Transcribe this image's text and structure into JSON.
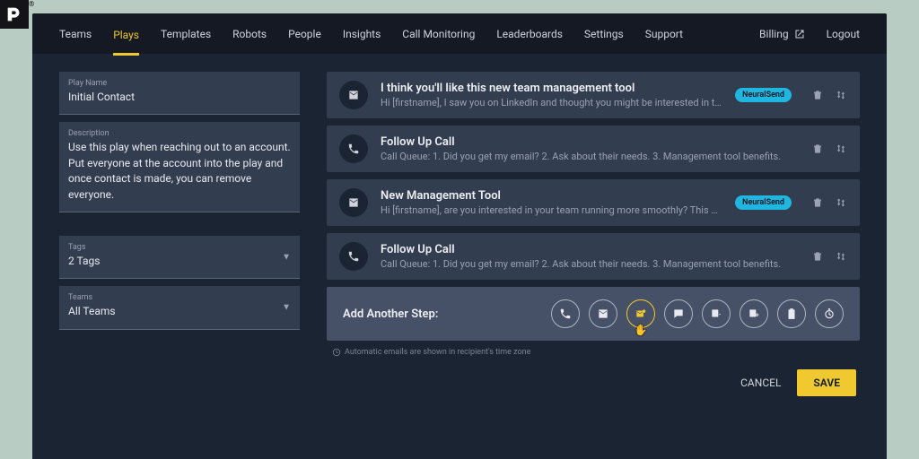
{
  "nav": {
    "items": [
      "Teams",
      "Plays",
      "Templates",
      "Robots",
      "People",
      "Insights",
      "Call Monitoring",
      "Leaderboards",
      "Settings",
      "Support"
    ],
    "active_index": 1,
    "billing": "Billing",
    "logout": "Logout"
  },
  "form": {
    "play_name_label": "Play Name",
    "play_name_value": "Initial Contact",
    "description_label": "Description",
    "description_value": "Use this play when reaching out to an account. Put everyone at the account into the play and once contact is made, you can remove everyone.",
    "tags_label": "Tags",
    "tags_value": "2 Tags",
    "teams_label": "Teams",
    "teams_value": "All Teams"
  },
  "steps": [
    {
      "icon": "email",
      "title": "I think you'll like this new team management tool",
      "sub": "Hi [firstname], I saw you on LinkedIn and thought you might be interested in this...",
      "badge": "NeuralSend"
    },
    {
      "icon": "phone",
      "title": "Follow Up Call",
      "sub": "Call Queue: 1. Did you get my email? 2. Ask about their needs. 3. Management tool benefits.",
      "badge": null
    },
    {
      "icon": "email",
      "title": "New Management Tool",
      "sub": "Hi [firstname], are you interested in your team running more smoothly? This new t…",
      "badge": "NeuralSend"
    },
    {
      "icon": "phone",
      "title": "Follow Up Call",
      "sub": "Call Queue: 1. Did you get my email? 2. Ask about their needs. 3. Management tool benefits.",
      "badge": null
    }
  ],
  "add": {
    "label": "Add Another Step:",
    "buttons": [
      "phone",
      "email",
      "smart-email",
      "chat",
      "task-add",
      "task-link",
      "clipboard",
      "clock"
    ],
    "hot_index": 2
  },
  "note": "Automatic emails are shown in recipient's time zone",
  "footer": {
    "cancel": "CANCEL",
    "save": "SAVE"
  }
}
